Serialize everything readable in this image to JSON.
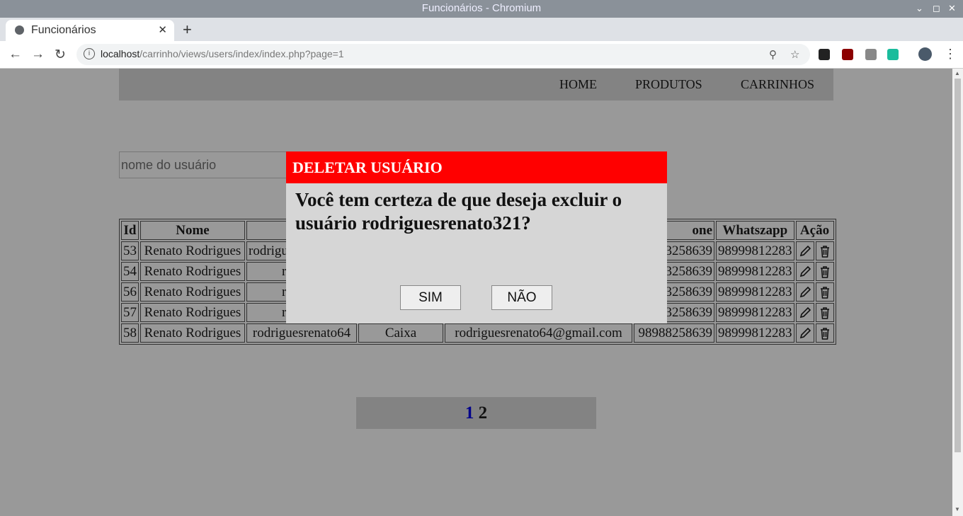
{
  "window": {
    "title": "Funcionários - Chromium"
  },
  "browser": {
    "tab_title": "Funcionários",
    "url_host": "localhost",
    "url_path": "/carrinho/views/users/index/index.php?page=1"
  },
  "nav": {
    "home": "HOME",
    "produtos": "PRODUTOS",
    "carrinhos": "CARRINHOS"
  },
  "search": {
    "placeholder": "nome do usuário"
  },
  "table": {
    "headers": [
      "Id",
      "Nome",
      "U",
      "",
      "",
      "one",
      "Whatszapp",
      "Ação"
    ],
    "rows": [
      {
        "id": "53",
        "nome": "Renato Rodrigues",
        "usuario": "rodrigu",
        "cargo": "",
        "email": "",
        "telefone": "3258639",
        "whatsapp": "98999812283"
      },
      {
        "id": "54",
        "nome": "Renato Rodrigues",
        "usuario": "rodrigu",
        "cargo": "",
        "email": "",
        "telefone": "3258639",
        "whatsapp": "98999812283"
      },
      {
        "id": "56",
        "nome": "Renato Rodrigues",
        "usuario": "rodrigu",
        "cargo": "",
        "email": "",
        "telefone": "3258639",
        "whatsapp": "98999812283"
      },
      {
        "id": "57",
        "nome": "Renato Rodrigues",
        "usuario": "rodrigu",
        "cargo": "",
        "email": "",
        "telefone": "3258639",
        "whatsapp": "98999812283"
      },
      {
        "id": "58",
        "nome": "Renato Rodrigues",
        "usuario": "rodriguesrenato64",
        "cargo": "Caixa",
        "email": "rodriguesrenato64@gmail.com",
        "telefone": "98988258639",
        "whatsapp": "98999812283"
      }
    ]
  },
  "pager": {
    "page1": "1",
    "page2": "2"
  },
  "modal": {
    "title": "DELETAR USUÁRIO",
    "message": "Você tem certeza de que deseja excluir o usuário rodriguesrenato321?",
    "yes": "SIM",
    "no": "NÃO"
  }
}
